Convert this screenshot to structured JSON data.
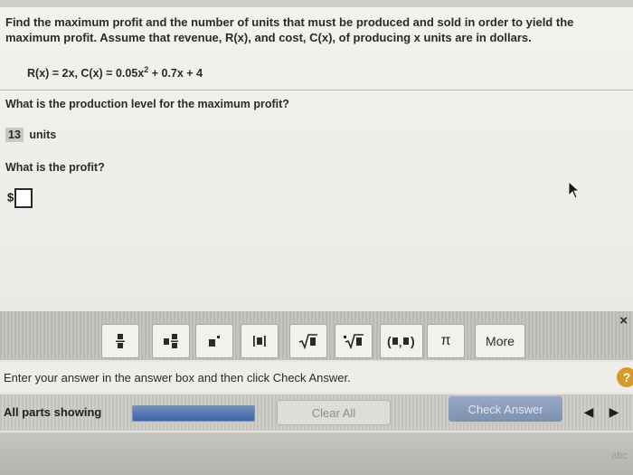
{
  "question": {
    "line1": "Find the maximum profit and the number of units that must be produced and sold in order to yield the",
    "line2": "maximum profit. Assume that revenue, R(x), and cost, C(x), of producing x units are in dollars.",
    "formula_left": "R(x) = 2x,  C(x) = 0.05x",
    "formula_exp": "2",
    "formula_right": " + 0.7x + 4"
  },
  "part1": {
    "prompt": "What is the production level for the maximum profit?",
    "answer_value": "13",
    "answer_unit": "units"
  },
  "part2": {
    "prompt": "What is the profit?",
    "currency": "$",
    "answer_value": ""
  },
  "toolbar": {
    "buttons": [
      {
        "name": "fraction-button",
        "glyph": "▪\n▪"
      },
      {
        "name": "mixed-number-button",
        "glyph": "▪▪"
      },
      {
        "name": "exponent-button",
        "glyph": "▪˙"
      },
      {
        "name": "absolute-value-button",
        "glyph": "|▪|"
      },
      {
        "name": "square-root-button",
        "glyph": "√▪"
      },
      {
        "name": "nth-root-button",
        "glyph": "∜▪"
      },
      {
        "name": "ordered-pair-button",
        "glyph": "(▪,▪)"
      },
      {
        "name": "pi-button",
        "glyph": "π"
      }
    ],
    "more_label": "More",
    "close_glyph": "×"
  },
  "instruction": "Enter your answer in the answer box and then click Check Answer.",
  "status": {
    "parts_label": "All parts showing",
    "progress_fraction": 1.0,
    "clear_label": "Clear All",
    "check_label": "Check Answer",
    "help_glyph": "?",
    "prev_glyph": "◀",
    "next_glyph": "▶"
  },
  "corner_text": "abc"
}
